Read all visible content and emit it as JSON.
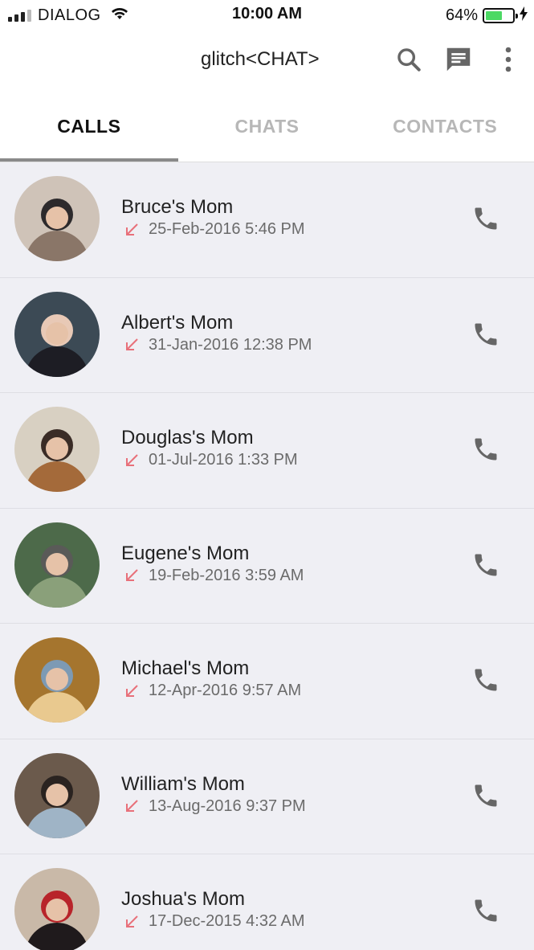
{
  "status_bar": {
    "carrier": "DIALOG",
    "time": "10:00 AM",
    "battery_percent": "64%",
    "battery_level": 0.64,
    "battery_color": "#4cd964"
  },
  "app_bar": {
    "title": "glitch<CHAT>",
    "icons": [
      "search-icon",
      "chat-icon",
      "more-vert-icon"
    ]
  },
  "tabs": [
    {
      "label": "CALLS",
      "active": true
    },
    {
      "label": "CHATS",
      "active": false
    },
    {
      "label": "CONTACTS",
      "active": false
    }
  ],
  "calls": [
    {
      "name": "Bruce's Mom",
      "time": "25-Feb-2016 5:46 PM",
      "direction": "missed-incoming"
    },
    {
      "name": "Albert's Mom",
      "time": "31-Jan-2016 12:38 PM",
      "direction": "missed-incoming"
    },
    {
      "name": "Douglas's Mom",
      "time": "01-Jul-2016 1:33 PM",
      "direction": "missed-incoming"
    },
    {
      "name": "Eugene's Mom",
      "time": "19-Feb-2016 3:59 AM",
      "direction": "missed-incoming"
    },
    {
      "name": "Michael's Mom",
      "time": "12-Apr-2016 9:57 AM",
      "direction": "missed-incoming"
    },
    {
      "name": "William's Mom",
      "time": "13-Aug-2016 9:37 PM",
      "direction": "missed-incoming"
    },
    {
      "name": "Joshua's Mom",
      "time": "17-Dec-2015 4:32 AM",
      "direction": "missed-incoming"
    }
  ],
  "colors": {
    "missed_arrow": "#e8707a",
    "icon_gray": "#666666",
    "active_tab_text": "#111111",
    "inactive_tab_text": "#b7b7b7",
    "list_background": "#efeff4"
  }
}
